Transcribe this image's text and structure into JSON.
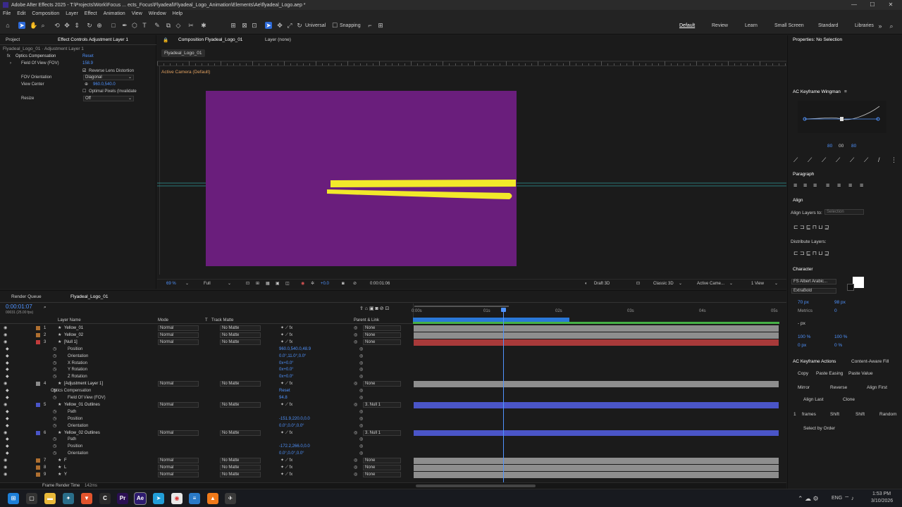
{
  "window": {
    "title": "Adobe After Effects 2025 - T:\\Projects\\Work\\Focus ... ects_Focus\\Flyadeal\\Flyadeal_Logo_Animation\\Elements\\Ae\\flyadeal_Logo.aep *",
    "minimize": "—",
    "maximize": "☐",
    "close": "✕"
  },
  "menu": [
    "File",
    "Edit",
    "Composition",
    "Layer",
    "Effect",
    "Animation",
    "View",
    "Window",
    "Help"
  ],
  "toolbar": {
    "universal": "Universal",
    "snapping": "Snapping"
  },
  "workspaces": [
    "Default",
    "Review",
    "Learn",
    "Small Screen",
    "Standard",
    "Libraries"
  ],
  "project_panel": {
    "tab_project": "Project",
    "tab_effect": "Effect Controls Adjustment Layer 1",
    "subtitle": "Flyadeal_Logo_01 · Adjustment Layer 1",
    "effect_name": "Optics Compensation",
    "reset": "Reset",
    "fov_label": "Field Of View (FOV)",
    "fov_value": "158.9",
    "reverse_label": "Reverse Lens Distortion",
    "fov_orient_label": "FOV Orientation",
    "fov_orient_value": "Diagonal",
    "view_center_label": "View Center",
    "view_center_value": "960.0,540.0",
    "optimal_label": "Optimal Pixels (Invalidate",
    "resize_label": "Resize",
    "resize_value": "Off"
  },
  "composition_panel": {
    "tab": "Composition Flyadeal_Logo_01",
    "layer_tab": "Layer (none)",
    "subtab": "Flyadeal_Logo_01",
    "camera_label": "Active Camera (Default)",
    "zoom": "69 %",
    "resolution": "Full",
    "exposure": "+0.0",
    "timecode": "0:00:01:06",
    "draft3d": "Draft 3D",
    "renderer": "Classic 3D",
    "camera": "Active Came...",
    "view": "1 View",
    "bg_color": "#6a1e7c",
    "stroke_color": "#f2e92a"
  },
  "properties": {
    "title": "Properties: No Selection"
  },
  "wingman": {
    "title": "AC Keyframe Wingman",
    "v1": "80",
    "v2": "00",
    "v3": "80"
  },
  "paragraph": {
    "title": "Paragraph"
  },
  "align": {
    "title": "Align",
    "align_to_label": "Align Layers to:",
    "align_to_value": "Selection",
    "distribute": "Distribute Layers:"
  },
  "character": {
    "title": "Character",
    "font": "FS Albert Arabic...",
    "style": "ExtraBold",
    "size": "70 px",
    "leading": "98 px",
    "kerning": "Metrics",
    "tracking": "0",
    "stroke": "- px",
    "vscale": "100 %",
    "hscale": "100 %",
    "baseline": "0 px",
    "tsume": "0 %"
  },
  "keyframe_actions": {
    "title": "AC Keyframe Actions",
    "other_tab": "Content-Aware Fill",
    "copy": "Copy",
    "paste_easing": "Paste Easing",
    "paste_value": "Paste Value",
    "mirror": "Mirror",
    "reverse": "Reverse",
    "align_first": "Align First",
    "align_last": "Align Last",
    "clone": "Clone",
    "count": "1",
    "frames": "frames",
    "shift1": "Shift",
    "shift2": "Shift",
    "random": "Random",
    "select_by_order": "Select by Order"
  },
  "timeline": {
    "tab_render": "Render Queue",
    "tab_comp": "Flyadeal_Logo_01",
    "timecode": "0:00:01:07",
    "frame_info": "00031 (25.00 fps)",
    "headers": {
      "name": "Layer Name",
      "mode": "Mode",
      "t": "T",
      "track": "Track Matte",
      "parent": "Parent & Link"
    },
    "ruler": [
      "0:00s",
      "01s",
      "02s",
      "03s",
      "04s",
      "05s"
    ],
    "footer": "Frame Render Time",
    "footer_value": "142ms",
    "rows": [
      {
        "num": "1",
        "name": "Yellow_01",
        "mode": "Normal",
        "track": "No Matte",
        "parent": "None",
        "kind": "layer",
        "color": "#b07030"
      },
      {
        "num": "2",
        "name": "Yellow_02",
        "mode": "Normal",
        "track": "No Matte",
        "parent": "None",
        "kind": "layer",
        "color": "#b07030"
      },
      {
        "num": "3",
        "name": "[Null 1]",
        "mode": "Normal",
        "track": "No Matte",
        "parent": "None",
        "kind": "layer",
        "color": "#c23b3b"
      },
      {
        "name": "Position",
        "value": "960.0,540.0,48.9",
        "kind": "prop"
      },
      {
        "name": "Orientation",
        "value": "0.0°,11.0°,0.0°",
        "kind": "prop"
      },
      {
        "name": "X Rotation",
        "value": "0x+0.0°",
        "kind": "prop"
      },
      {
        "name": "Y Rotation",
        "value": "0x+0.0°",
        "kind": "prop"
      },
      {
        "name": "Z Rotation",
        "value": "0x+0.0°",
        "kind": "prop"
      },
      {
        "num": "4",
        "name": "[Adjustment Layer 1]",
        "mode": "Normal",
        "track": "No Matte",
        "parent": "None",
        "kind": "layer",
        "color": "#8c8c8c"
      },
      {
        "name": "Optics Compensation",
        "value": "Reset",
        "kind": "group"
      },
      {
        "name": "Field Of View (FOV)",
        "value": "94.8",
        "kind": "prop"
      },
      {
        "num": "5",
        "name": "Yellow_01 Outlines",
        "mode": "Normal",
        "track": "No Matte",
        "parent": "3. Null 1",
        "kind": "layer",
        "color": "#4a55c8"
      },
      {
        "name": "Path",
        "value": "",
        "kind": "prop"
      },
      {
        "name": "Position",
        "value": "-151.9,220.0,0.0",
        "kind": "prop"
      },
      {
        "name": "Orientation",
        "value": "0.0°,0.0°,0.0°",
        "kind": "prop"
      },
      {
        "num": "6",
        "name": "Yellow_02 Outlines",
        "mode": "Normal",
        "track": "No Matte",
        "parent": "3. Null 1",
        "kind": "layer",
        "color": "#4a55c8"
      },
      {
        "name": "Path",
        "value": "",
        "kind": "prop"
      },
      {
        "name": "Position",
        "value": "-172.2,266.0,0.0",
        "kind": "prop"
      },
      {
        "name": "Orientation",
        "value": "0.0°,0.0°,0.0°",
        "kind": "prop"
      },
      {
        "num": "7",
        "name": "F",
        "mode": "Normal",
        "track": "No Matte",
        "parent": "None",
        "kind": "layer",
        "color": "#b07030"
      },
      {
        "num": "8",
        "name": "L",
        "mode": "Normal",
        "track": "No Matte",
        "parent": "None",
        "kind": "layer",
        "color": "#b07030"
      },
      {
        "num": "9",
        "name": "Y",
        "mode": "Normal",
        "track": "No Matte",
        "parent": "None",
        "kind": "layer",
        "color": "#b07030"
      }
    ]
  },
  "taskbar": {
    "lang": "ENG",
    "time": "1:53 PM",
    "date": "3/10/2026"
  }
}
